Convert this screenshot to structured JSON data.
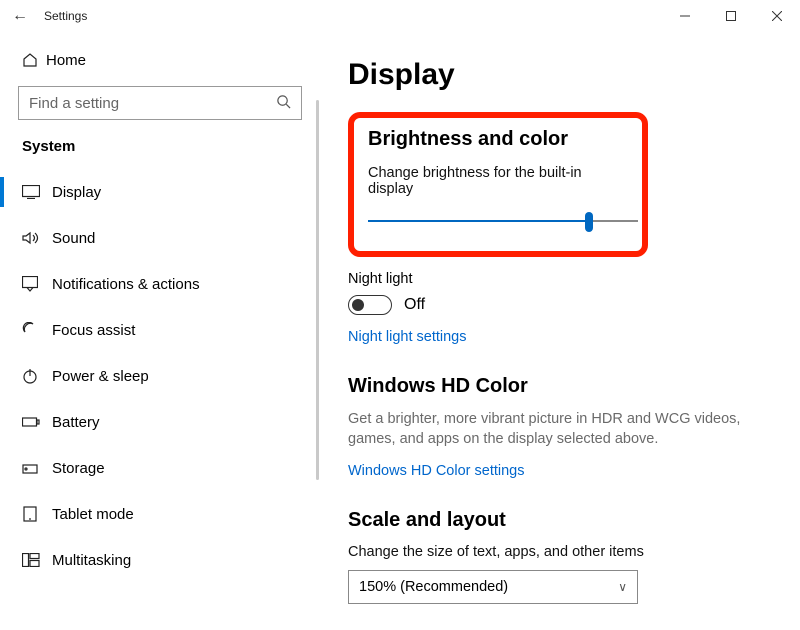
{
  "titlebar": {
    "title": "Settings"
  },
  "sidebar": {
    "home": "Home",
    "search_placeholder": "Find a setting",
    "section": "System",
    "items": [
      {
        "label": "Display"
      },
      {
        "label": "Sound"
      },
      {
        "label": "Notifications & actions"
      },
      {
        "label": "Focus assist"
      },
      {
        "label": "Power & sleep"
      },
      {
        "label": "Battery"
      },
      {
        "label": "Storage"
      },
      {
        "label": "Tablet mode"
      },
      {
        "label": "Multitasking"
      }
    ]
  },
  "main": {
    "page_title": "Display",
    "brightness": {
      "heading": "Brightness and color",
      "label": "Change brightness for the built-in display",
      "value_pct": 82
    },
    "night": {
      "label": "Night light",
      "state": "Off",
      "link": "Night light settings"
    },
    "hd": {
      "heading": "Windows HD Color",
      "desc": "Get a brighter, more vibrant picture in HDR and WCG videos, games, and apps on the display selected above.",
      "link": "Windows HD Color settings"
    },
    "scale": {
      "heading": "Scale and layout",
      "label": "Change the size of text, apps, and other items",
      "value": "150% (Recommended)"
    }
  }
}
